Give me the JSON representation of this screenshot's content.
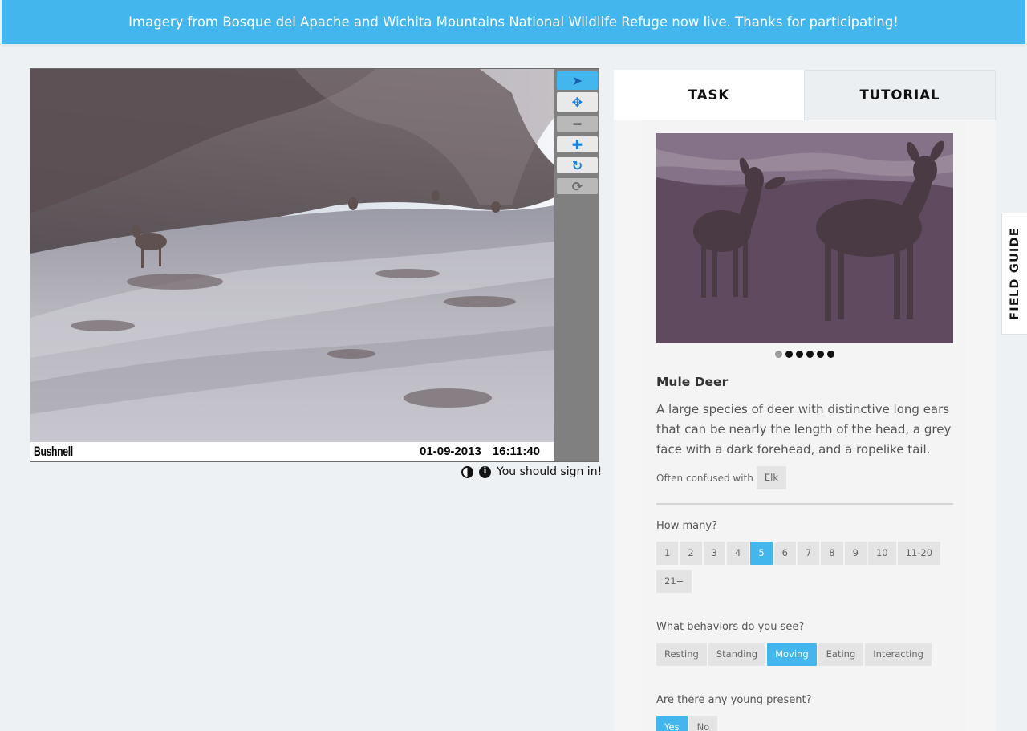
{
  "banner": {
    "text": "Imagery from Bosque del Apache and Wichita Mountains National Wildlife Refuge now live. Thanks for participating!"
  },
  "viewer": {
    "camera_brand": "Bushnell",
    "date": "01-09-2013",
    "time": "16:11:40",
    "tools": [
      {
        "name": "select-icon",
        "glyph": "➤"
      },
      {
        "name": "move-icon",
        "glyph": "✥"
      },
      {
        "name": "zoom-out-icon",
        "glyph": "━"
      },
      {
        "name": "zoom-in-icon",
        "glyph": "✚"
      },
      {
        "name": "rotate-icon",
        "glyph": "↻"
      },
      {
        "name": "reset-icon",
        "glyph": "⟳"
      }
    ],
    "sign_in_text": "You should sign in!"
  },
  "tabs": {
    "task": "TASK",
    "tutorial": "TUTORIAL"
  },
  "field_guide": "FIELD GUIDE",
  "species": {
    "name": "Mule Deer",
    "description": "A large species of deer with distinctive long ears that can be nearly the length of the head, a grey face with a dark forehead, and a ropelike tail.",
    "confused_label": "Often confused with",
    "confused_with": "Elk",
    "photo_count": 6,
    "current_photo": 1
  },
  "questions": {
    "how_many": {
      "label": "How many?",
      "options": [
        "1",
        "2",
        "3",
        "4",
        "5",
        "6",
        "7",
        "8",
        "9",
        "10",
        "11-20",
        "21+"
      ],
      "selected": "5"
    },
    "behaviors": {
      "label": "What behaviors do you see?",
      "options": [
        "Resting",
        "Standing",
        "Moving",
        "Eating",
        "Interacting"
      ],
      "selected": [
        "Moving"
      ]
    },
    "young": {
      "label": "Are there any young present?",
      "options": [
        "Yes",
        "No"
      ],
      "selected": "Yes"
    }
  },
  "colors": {
    "accent": "#43b6ee",
    "tool_icon": "#1a7fe0"
  }
}
